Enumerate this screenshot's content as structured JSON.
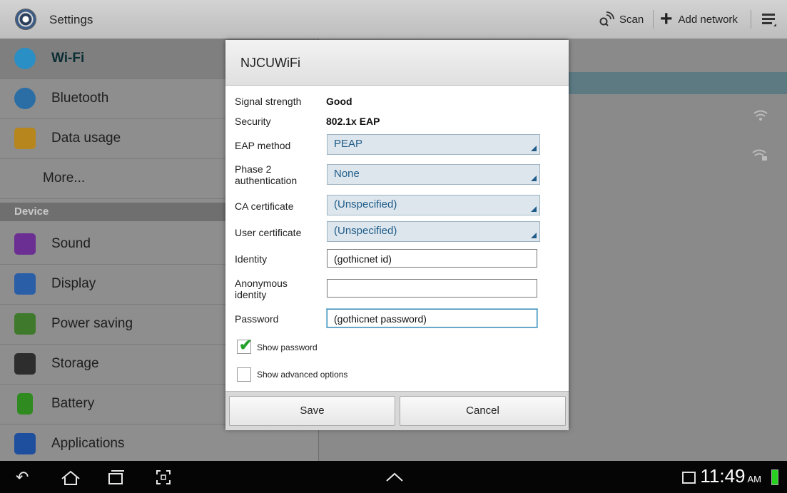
{
  "topbar": {
    "title": "Settings",
    "scan_label": "Scan",
    "add_network_label": "Add network"
  },
  "sidebar": {
    "items": [
      {
        "label": "Wi-Fi"
      },
      {
        "label": "Bluetooth"
      },
      {
        "label": "Data usage"
      },
      {
        "label": "More..."
      },
      {
        "label": "Sound"
      },
      {
        "label": "Display"
      },
      {
        "label": "Power saving"
      },
      {
        "label": "Storage"
      },
      {
        "label": "Battery"
      },
      {
        "label": "Applications"
      }
    ],
    "section_header": "Device"
  },
  "dialog": {
    "title": "NJCUWiFi",
    "signal_label": "Signal strength",
    "signal_value": "Good",
    "security_label": "Security",
    "security_value": "802.1x EAP",
    "eap_label": "EAP method",
    "eap_value": "PEAP",
    "phase2_label_1": "Phase 2",
    "phase2_label_2": "authentication",
    "phase2_value": "None",
    "ca_label": "CA certificate",
    "ca_value": "(Unspecified)",
    "user_cert_label": "User certificate",
    "user_cert_value": "(Unspecified)",
    "identity_label": "Identity",
    "identity_value": "(gothicnet id)",
    "anon_label_1": "Anonymous",
    "anon_label_2": "identity",
    "anon_value": "",
    "password_label": "Password",
    "password_value": "(gothicnet password)",
    "show_password_label": "Show password",
    "show_password_checked": true,
    "advanced_label": "Show advanced options",
    "advanced_checked": false,
    "save_label": "Save",
    "cancel_label": "Cancel"
  },
  "statusbar": {
    "time": "11:49",
    "ampm": "AM"
  },
  "colors": {
    "accent": "#1f5c8a",
    "selected_bar": "#5d7a83",
    "battery": "#28d01f"
  }
}
